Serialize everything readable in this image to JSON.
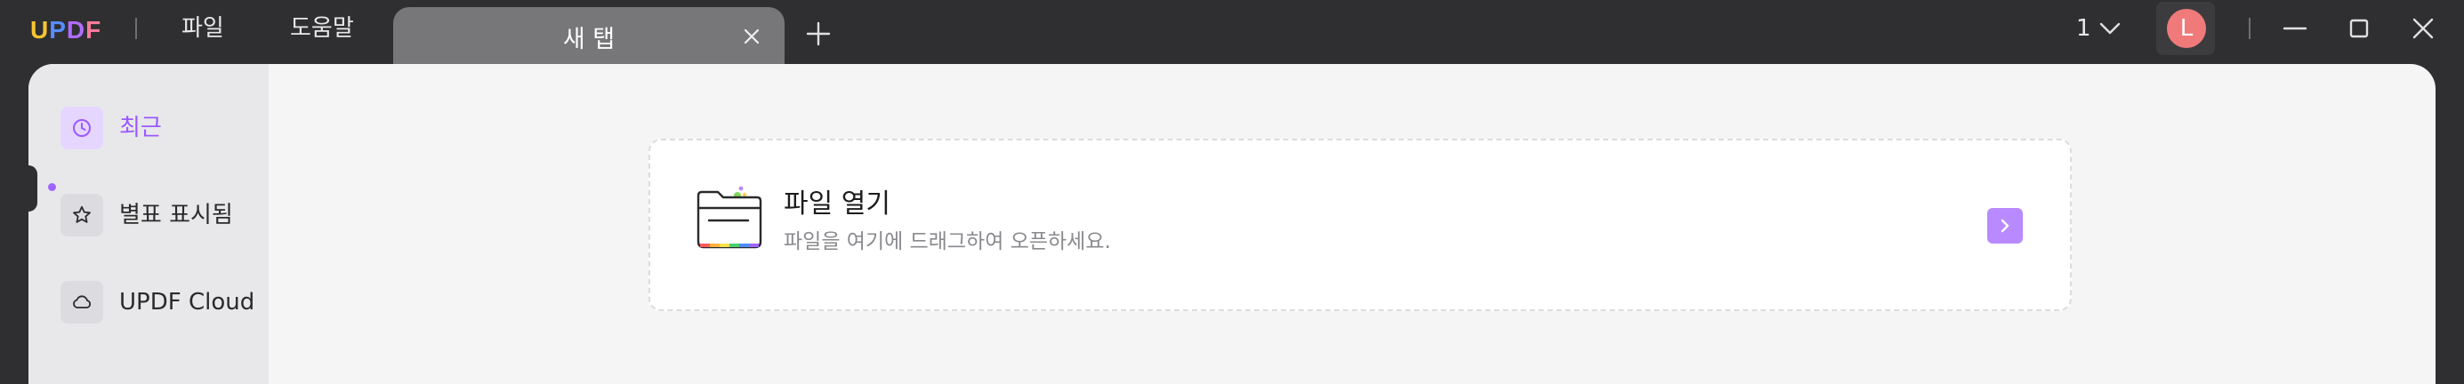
{
  "app": {
    "logo_letters": [
      "U",
      "P",
      "D",
      "F"
    ]
  },
  "menu": {
    "file": "파일",
    "help": "도움말"
  },
  "tabs": [
    {
      "label": "새 탭"
    }
  ],
  "topbar": {
    "page_selector": "1",
    "avatar_initial": "L"
  },
  "sidebar": {
    "items": [
      {
        "label": "최근",
        "icon": "clock-icon",
        "active": true
      },
      {
        "label": "별표 표시됨",
        "icon": "star-icon",
        "active": false
      },
      {
        "label": "UPDF Cloud",
        "icon": "cloud-icon",
        "active": false
      }
    ]
  },
  "open_file": {
    "title": "파일 열기",
    "subtitle": "파일을 여기에 드래그하여 오픈하세요."
  },
  "colors": {
    "accent": "#9b59ff",
    "titlebar": "#2f2f31",
    "avatar": "#f07a7a"
  }
}
